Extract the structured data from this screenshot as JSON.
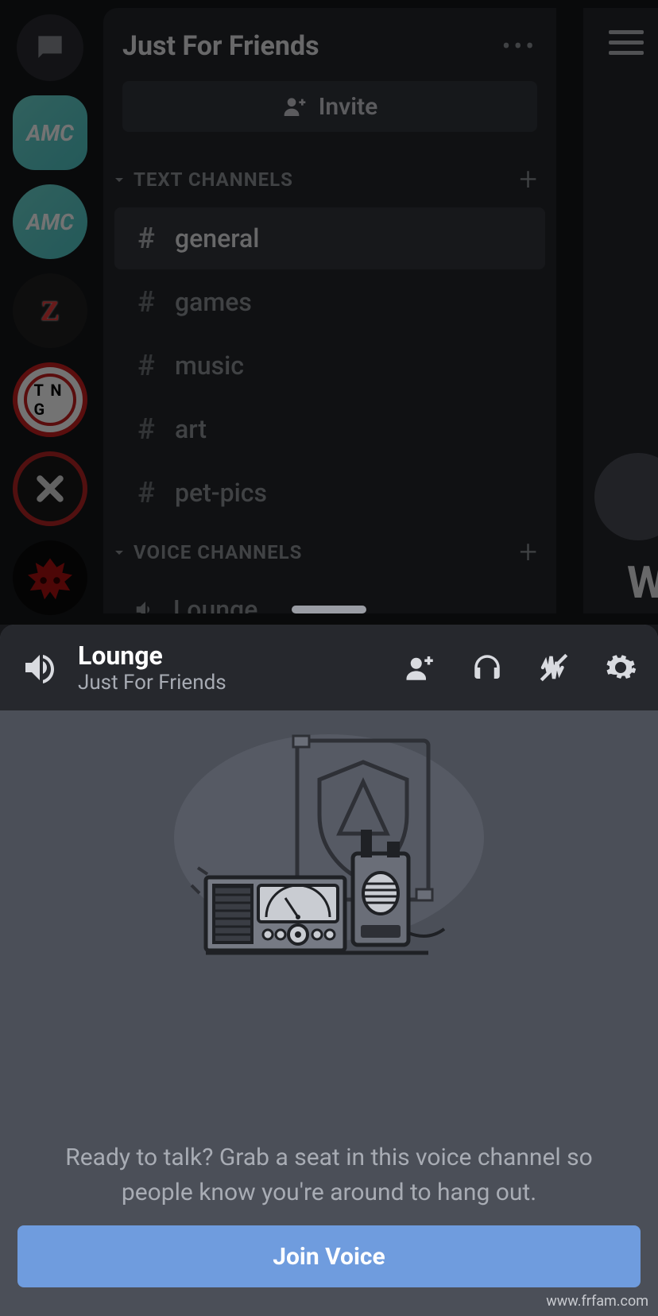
{
  "server": {
    "name": "Just For Friends",
    "invite_label": "Invite"
  },
  "sections": {
    "text_label": "TEXT CHANNELS",
    "voice_label": "VOICE CHANNELS"
  },
  "text_channels": [
    {
      "name": "general",
      "selected": true
    },
    {
      "name": "games",
      "selected": false
    },
    {
      "name": "music",
      "selected": false
    },
    {
      "name": "art",
      "selected": false
    },
    {
      "name": "pet-pics",
      "selected": false
    }
  ],
  "voice_channels": [
    {
      "name": "Lounge"
    }
  ],
  "voice_panel": {
    "channel": "Lounge",
    "server": "Just For Friends",
    "prompt": "Ready to talk? Grab a seat in this voice channel so people know you're around to hang out.",
    "join_label": "Join Voice"
  },
  "server_rail": {
    "dm_icon": "speech-bubble-icon",
    "servers": [
      "AMC",
      "AMC",
      "Z",
      "TNG",
      "X",
      "BOWSER"
    ]
  },
  "members_sliver": {
    "letter": "W"
  },
  "watermark": "www.frfam.com"
}
